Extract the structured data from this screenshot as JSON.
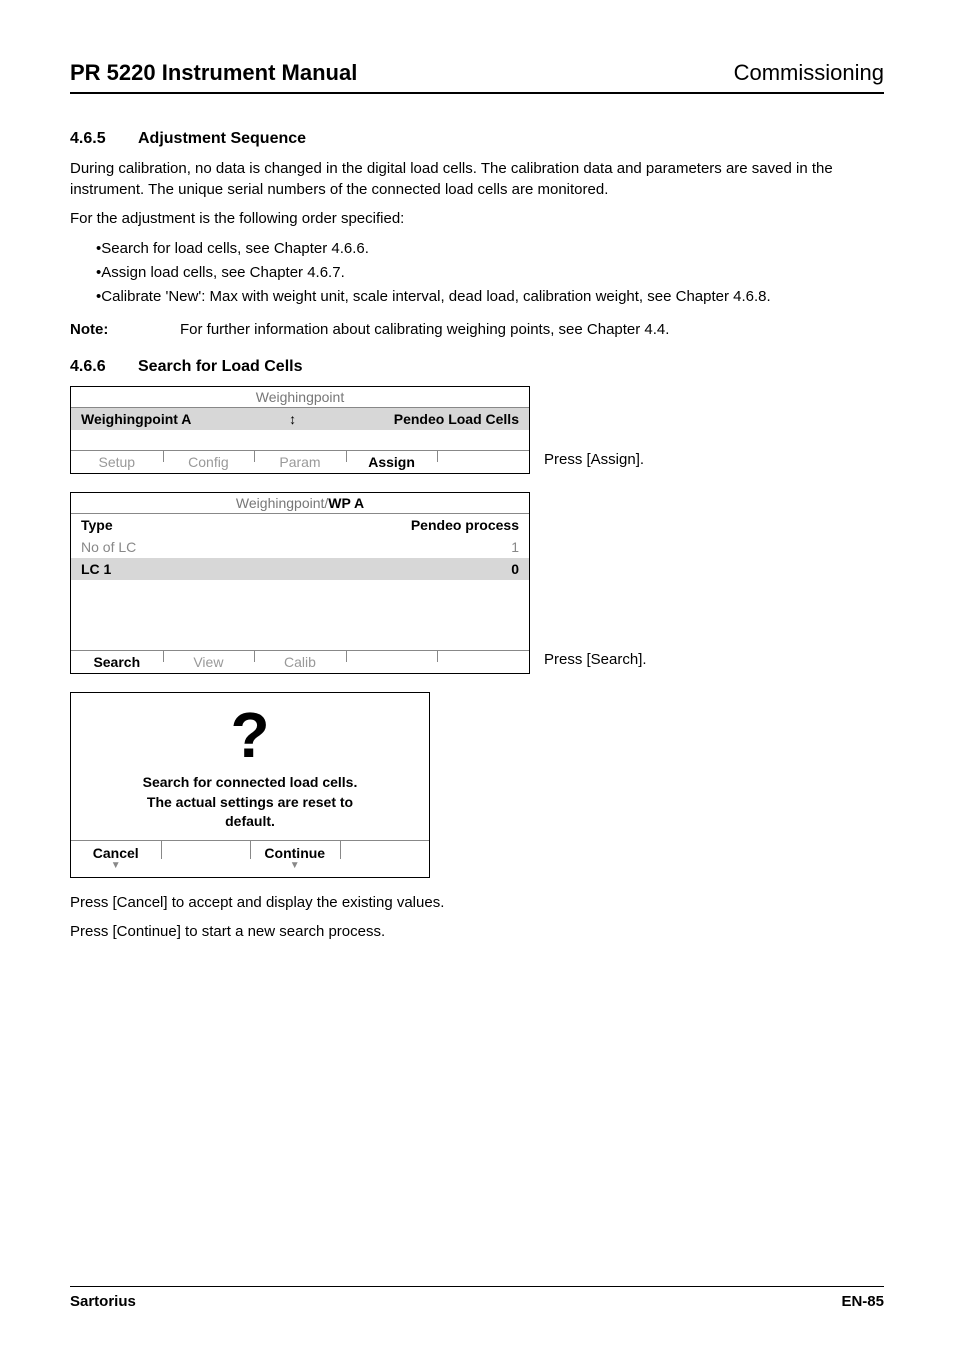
{
  "header": {
    "left": "PR 5220 Instrument Manual",
    "right": "Commissioning"
  },
  "section_465": {
    "number": "4.6.5",
    "title": "Adjustment Sequence",
    "para1": "During calibration, no data is changed in the digital load cells. The calibration data and parameters are saved in the instrument. The unique serial numbers of the connected load cells are monitored.",
    "para2": "For the adjustment is the following order specified:",
    "bullets": [
      "Search for load cells, see Chapter 4.6.6.",
      "Assign load cells, see Chapter 4.6.7.",
      "Calibrate 'New': Max with weight unit, scale interval, dead load, calibration weight, see Chapter 4.6.8."
    ],
    "note_label": "Note:",
    "note_text": "For further information about calibrating weighing points, see Chapter 4.4."
  },
  "section_466": {
    "number": "4.6.6",
    "title": "Search for Load Cells"
  },
  "screen1": {
    "title": "Weighingpoint",
    "wp_label": "Weighingpoint A",
    "wp_icon": "↕",
    "wp_value": "Pendeo Load Cells",
    "buttons": [
      "Setup",
      "Config",
      "Param",
      "Assign",
      ""
    ],
    "active_index": 3,
    "caption": "Press [Assign]."
  },
  "screen2": {
    "title_gray": "Weighingpoint/",
    "title_strong": "WP A",
    "rows": [
      {
        "label": "Type",
        "value": "Pendeo process",
        "label_gray": false,
        "value_gray": false,
        "highlight": false
      },
      {
        "label": "No of LC",
        "value": "1",
        "label_gray": true,
        "value_gray": true,
        "highlight": false
      },
      {
        "label": "LC 1",
        "value": "0",
        "label_gray": false,
        "value_gray": false,
        "highlight": true
      }
    ],
    "buttons": [
      "Search",
      "View",
      "Calib",
      "",
      ""
    ],
    "active_index": 0,
    "caption": "Press [Search]."
  },
  "dialog": {
    "mark": "?",
    "line1": "Search for connected load cells.",
    "line2": "The actual settings are reset to",
    "line3": "default.",
    "cancel": "Cancel",
    "cont": "Continue"
  },
  "after_dialog": {
    "p1": "Press [Cancel] to accept and display the existing values.",
    "p2": "Press [Continue] to start a new search process."
  },
  "footer": {
    "left": "Sartorius",
    "right": "EN-85"
  }
}
